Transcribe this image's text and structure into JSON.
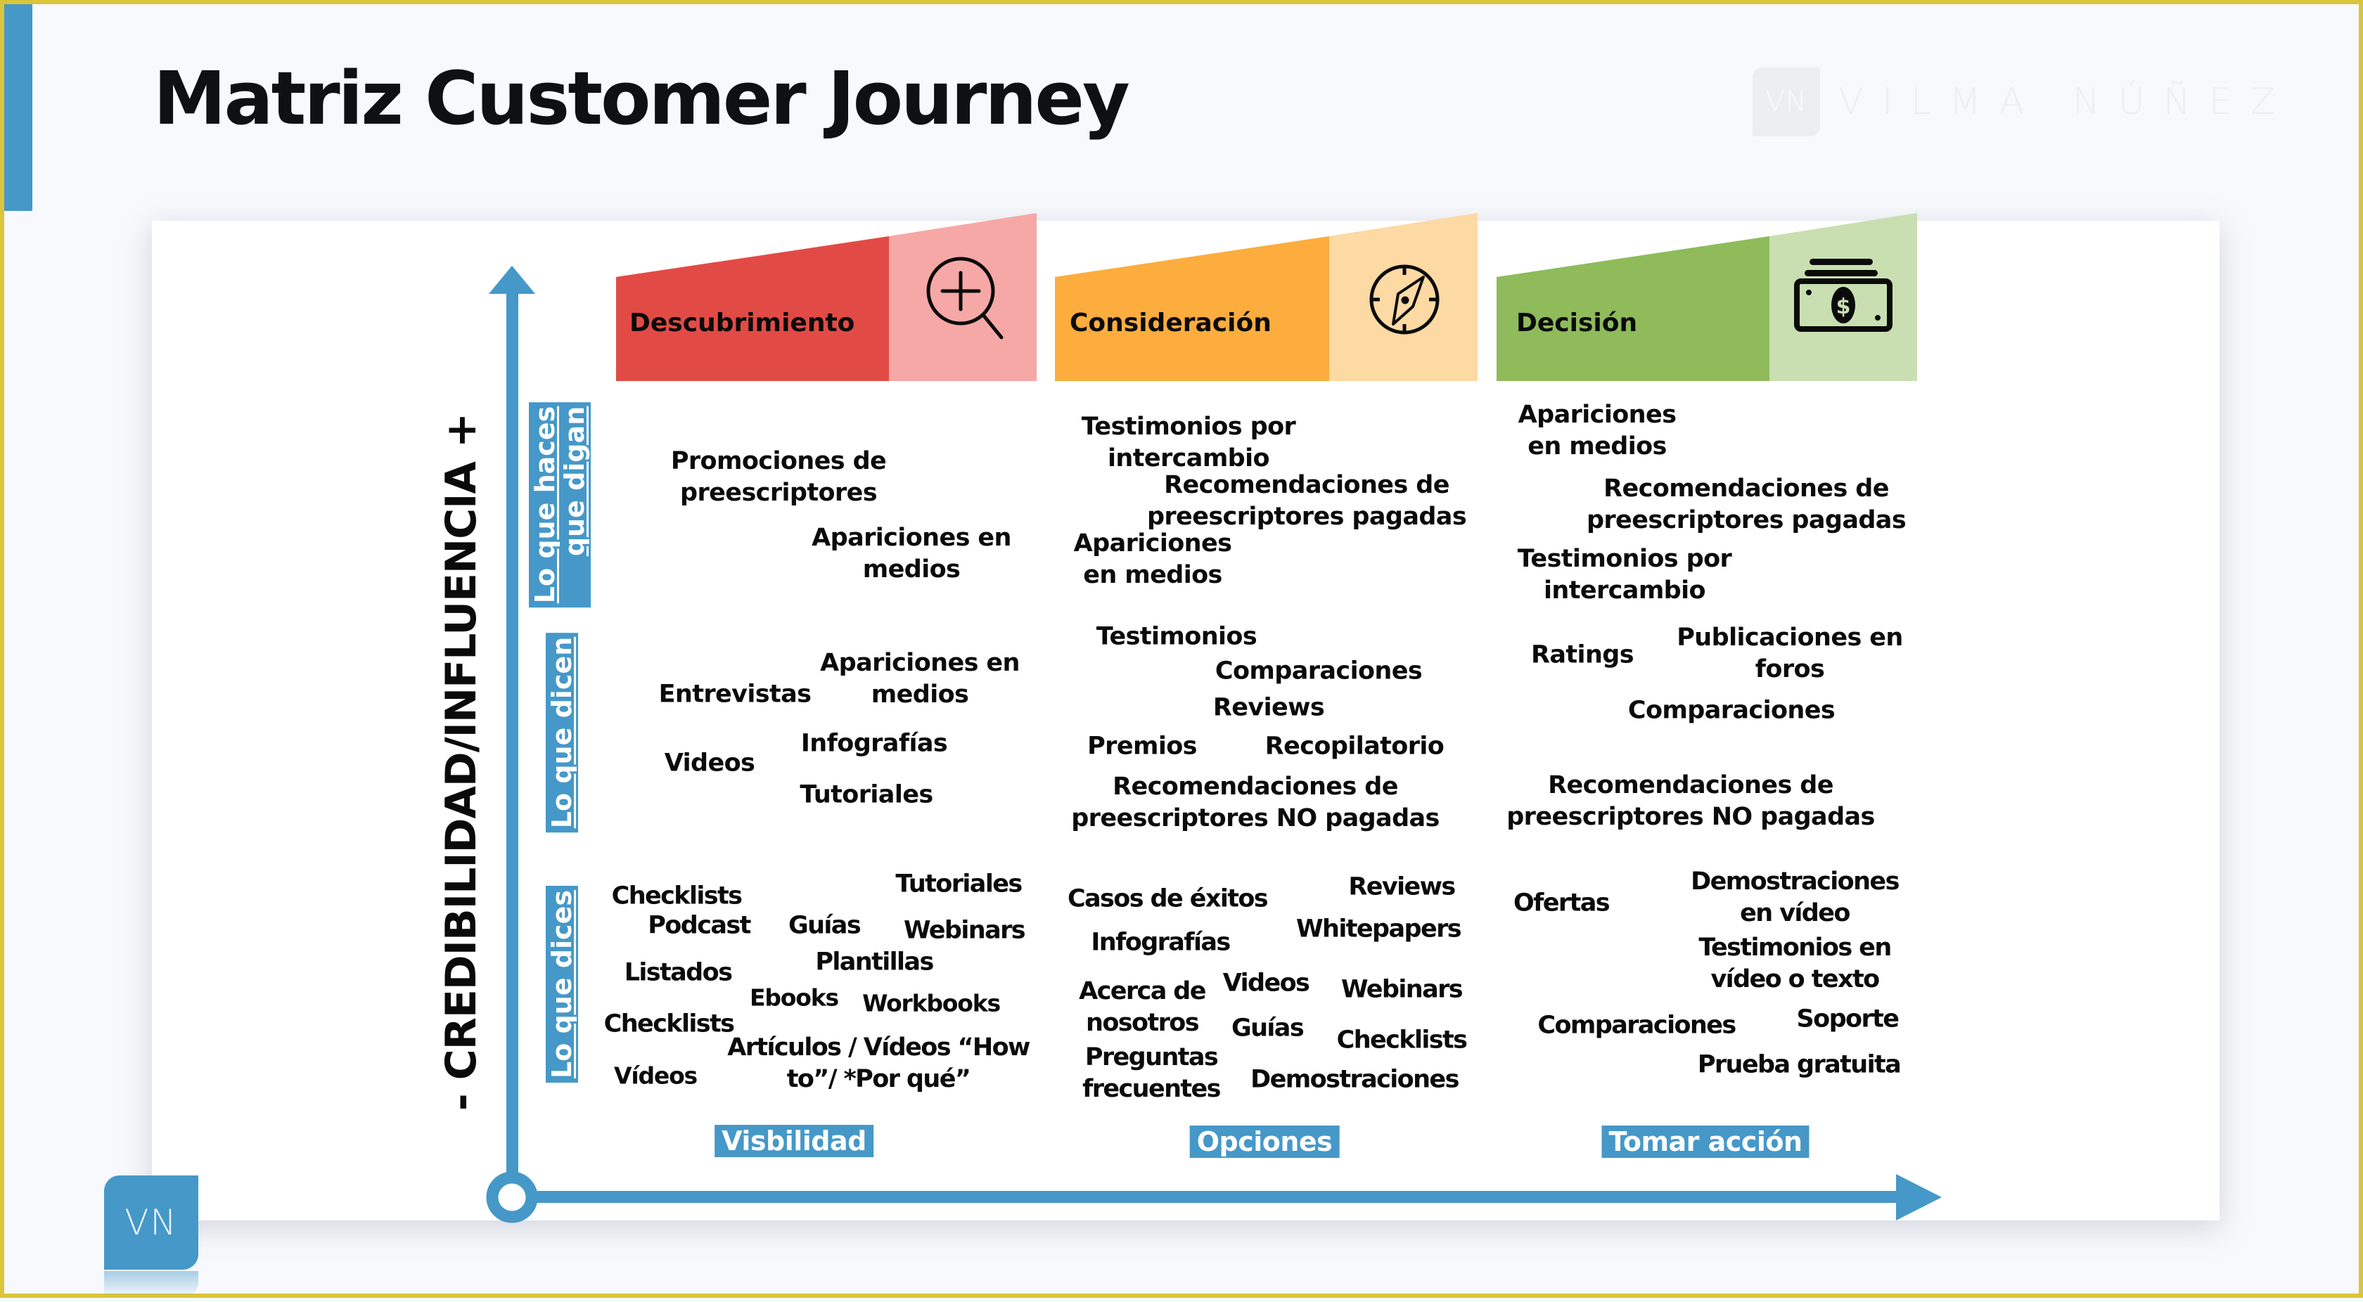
{
  "title": "Matriz Customer Journey",
  "brand": {
    "mark": "VN",
    "name": "VILMA NÚÑEZ"
  },
  "colors": {
    "accent_blue": "#4598c8",
    "descubrimiento": "#e24b45",
    "descubrimiento_light": "#f6a8a6",
    "consideracion": "#fcad3e",
    "consideracion_light": "#fdd9a3",
    "decision": "#8fbb5b",
    "decision_light": "#c9dfb1"
  },
  "y_axis": {
    "label": "- CREDIBILIDAD/INFLUENCIA +"
  },
  "rows": [
    {
      "label": "Lo que haces\nque digan"
    },
    {
      "label": "Lo que dicen"
    },
    {
      "label": "Lo que dices"
    }
  ],
  "columns": [
    {
      "title": "Descubrimiento",
      "icon": "magnifier-plus-icon",
      "footer": "Visbilidad",
      "row_haces_que_digan": [
        "Promociones de\npreescriptores",
        "Apariciones en\nmedios"
      ],
      "row_dicen": [
        "Entrevistas",
        "Apariciones en\nmedios",
        "Videos",
        "Infografías",
        "Tutoriales"
      ],
      "row_dices": [
        "Checklists",
        "Tutoriales",
        "Podcast",
        "Guías",
        "Webinars",
        "Plantillas",
        "Listados",
        "Ebooks",
        "Workbooks",
        "Checklists",
        "Artículos / Vídeos “How\nto”/ *Por qué”",
        "Vídeos"
      ]
    },
    {
      "title": "Consideración",
      "icon": "compass-icon",
      "footer": "Opciones",
      "row_haces_que_digan": [
        "Testimonios por\nintercambio",
        "Recomendaciones de\npreescriptores pagadas",
        "Apariciones\nen medios"
      ],
      "row_dicen": [
        "Testimonios",
        "Comparaciones",
        "Reviews",
        "Premios",
        "Recopilatorio",
        "Recomendaciones de\npreescriptores NO pagadas"
      ],
      "row_dices": [
        "Casos de éxitos",
        "Reviews",
        "Whitepapers",
        "Infografías",
        "Acerca de\nnosotros",
        "Videos",
        "Webinars",
        "Guías",
        "Checklists",
        "Preguntas\nfrecuentes",
        "Demostraciones"
      ]
    },
    {
      "title": "Decisión",
      "icon": "money-bill-icon",
      "footer": "Tomar acción",
      "row_haces_que_digan": [
        "Apariciones\nen medios",
        "Recomendaciones de\npreescriptores pagadas",
        "Testimonios por\nintercambio"
      ],
      "row_dicen": [
        "Ratings",
        "Publicaciones en\nforos",
        "Comparaciones",
        "Recomendaciones de\npreescriptores NO pagadas"
      ],
      "row_dices": [
        "Ofertas",
        "Demostraciones\nen vídeo",
        "Testimonios en\nvídeo o texto",
        "Comparaciones",
        "Soporte",
        "Prueba gratuita"
      ]
    }
  ]
}
